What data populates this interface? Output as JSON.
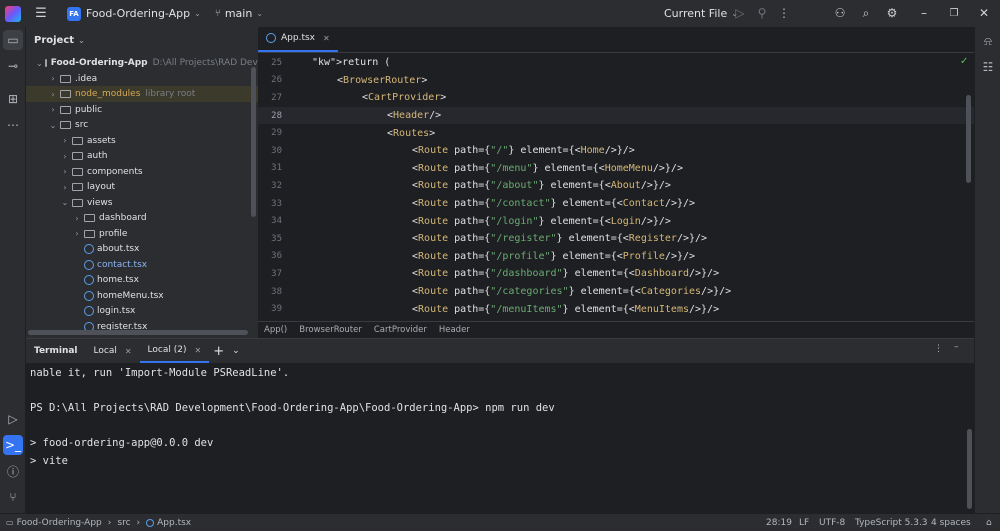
{
  "titlebar": {
    "project_badge": "FA",
    "project_name": "Food-Ordering-App",
    "branch": "main",
    "run_config": "Current File"
  },
  "project_panel": {
    "title": "Project",
    "tree": [
      {
        "label": "Food-Ordering-App",
        "hint": "D:\\All Projects\\RAD Devel",
        "indent": 0,
        "kind": "folder",
        "open": true
      },
      {
        "label": ".idea",
        "hint": "",
        "indent": 1,
        "kind": "folder",
        "open": false
      },
      {
        "label": "node_modules",
        "hint": "library root",
        "indent": 1,
        "kind": "folder",
        "open": false
      },
      {
        "label": "public",
        "hint": "",
        "indent": 1,
        "kind": "folder",
        "open": false
      },
      {
        "label": "src",
        "hint": "",
        "indent": 1,
        "kind": "folder",
        "open": true
      },
      {
        "label": "assets",
        "hint": "",
        "indent": 2,
        "kind": "folder",
        "open": false
      },
      {
        "label": "auth",
        "hint": "",
        "indent": 2,
        "kind": "folder",
        "open": false
      },
      {
        "label": "components",
        "hint": "",
        "indent": 2,
        "kind": "folder",
        "open": false
      },
      {
        "label": "layout",
        "hint": "",
        "indent": 2,
        "kind": "folder",
        "open": false
      },
      {
        "label": "views",
        "hint": "",
        "indent": 2,
        "kind": "folder",
        "open": true
      },
      {
        "label": "dashboard",
        "hint": "",
        "indent": 3,
        "kind": "folder",
        "open": false
      },
      {
        "label": "profile",
        "hint": "",
        "indent": 3,
        "kind": "folder",
        "open": false
      },
      {
        "label": "about.tsx",
        "hint": "",
        "indent": 3,
        "kind": "file"
      },
      {
        "label": "contact.tsx",
        "hint": "",
        "indent": 3,
        "kind": "file"
      },
      {
        "label": "home.tsx",
        "hint": "",
        "indent": 3,
        "kind": "file"
      },
      {
        "label": "homeMenu.tsx",
        "hint": "",
        "indent": 3,
        "kind": "file"
      },
      {
        "label": "login.tsx",
        "hint": "",
        "indent": 3,
        "kind": "file"
      },
      {
        "label": "register.tsx",
        "hint": "",
        "indent": 3,
        "kind": "file"
      }
    ]
  },
  "editor": {
    "tab_label": "App.tsx",
    "lines": [
      {
        "num": "25",
        "indent": 1,
        "text": "return ("
      },
      {
        "num": "26",
        "indent": 2,
        "text": "<BrowserRouter>"
      },
      {
        "num": "27",
        "indent": 3,
        "text": "<CartProvider>"
      },
      {
        "num": "28",
        "indent": 4,
        "text": "<Header/>"
      },
      {
        "num": "29",
        "indent": 4,
        "text": "<Routes>"
      },
      {
        "num": "30",
        "indent": 5,
        "text": "<Route path={\"/\"} element={<Home/>}/>"
      },
      {
        "num": "31",
        "indent": 5,
        "text": "<Route path={\"/menu\"} element={<HomeMenu/>}/>"
      },
      {
        "num": "32",
        "indent": 5,
        "text": "<Route path={\"/about\"} element={<About/>}/>"
      },
      {
        "num": "33",
        "indent": 5,
        "text": "<Route path={\"/contact\"} element={<Contact/>}/>"
      },
      {
        "num": "34",
        "indent": 5,
        "text": "<Route path={\"/login\"} element={<Login/>}/>"
      },
      {
        "num": "35",
        "indent": 5,
        "text": "<Route path={\"/register\"} element={<Register/>}/>"
      },
      {
        "num": "36",
        "indent": 5,
        "text": "<Route path={\"/profile\"} element={<Profile/>}/>"
      },
      {
        "num": "37",
        "indent": 5,
        "text": "<Route path={\"/dashboard\"} element={<Dashboard/>}/>"
      },
      {
        "num": "38",
        "indent": 5,
        "text": "<Route path={\"/categories\"} element={<Categories/>}/>"
      },
      {
        "num": "39",
        "indent": 5,
        "text": "<Route path={\"/menuItems\"} element={<MenuItems/>}/>"
      }
    ],
    "current_line": "28",
    "breadcrumbs": [
      "App()",
      "BrowserRouter",
      "CartProvider",
      "Header"
    ]
  },
  "terminal": {
    "title": "Terminal",
    "tabs": [
      "Local",
      "Local (2)"
    ],
    "lines": [
      "nable it, run 'Import-Module PSReadLine'.",
      "",
      "PS D:\\All Projects\\RAD Development\\Food-Ordering-App\\Food-Ordering-App> npm run dev",
      "",
      "> food-ordering-app@0.0.0 dev",
      "> vite"
    ]
  },
  "statusbar": {
    "path": [
      "Food-Ordering-App",
      "src",
      "App.tsx"
    ],
    "position": "28:19",
    "line_ending": "LF",
    "encoding": "UTF-8",
    "language": "TypeScript 5.3.3",
    "indent": "4 spaces"
  }
}
